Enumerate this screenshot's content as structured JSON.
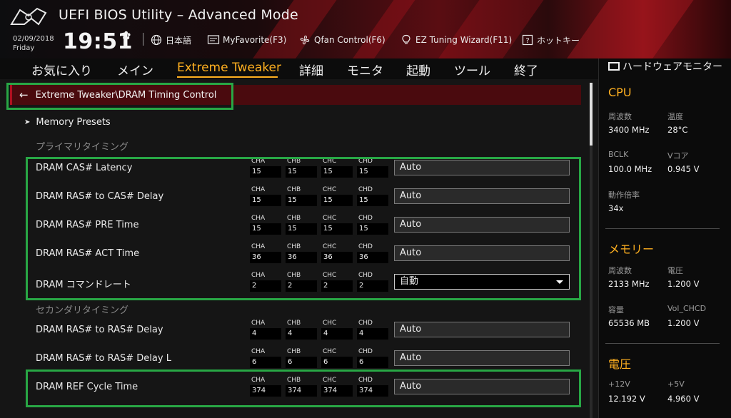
{
  "header": {
    "title": "UEFI BIOS Utility – Advanced Mode",
    "date": "02/09/2018",
    "day": "Friday",
    "time": "19:51",
    "items": [
      {
        "label": "日本語",
        "icon": "globe-icon"
      },
      {
        "label": "MyFavorite(F3)",
        "icon": "favorite-icon"
      },
      {
        "label": "Qfan Control(F6)",
        "icon": "fan-icon"
      },
      {
        "label": "EZ Tuning Wizard(F11)",
        "icon": "bulb-icon"
      },
      {
        "label": "ホットキー",
        "icon": "hotkey-icon"
      }
    ]
  },
  "nav": {
    "tabs": [
      "お気に入り",
      "メイン",
      "Extreme Tweaker",
      "詳細",
      "モニタ",
      "起動",
      "ツール",
      "終了"
    ],
    "active": "Extreme Tweaker"
  },
  "breadcrumb": "Extreme Tweaker\\DRAM Timing Control",
  "presets": "Memory Presets",
  "sections": {
    "primary": "プライマリタイミング",
    "secondary": "セカンダリタイミング"
  },
  "channels": [
    "CHA",
    "CHB",
    "CHC",
    "CHD"
  ],
  "rows": [
    {
      "label": "DRAM CAS# Latency",
      "values": [
        "15",
        "15",
        "15",
        "15"
      ],
      "setting": "Auto"
    },
    {
      "label": "DRAM RAS# to CAS# Delay",
      "values": [
        "15",
        "15",
        "15",
        "15"
      ],
      "setting": "Auto"
    },
    {
      "label": "DRAM RAS# PRE Time",
      "values": [
        "15",
        "15",
        "15",
        "15"
      ],
      "setting": "Auto"
    },
    {
      "label": "DRAM RAS# ACT Time",
      "values": [
        "36",
        "36",
        "36",
        "36"
      ],
      "setting": "Auto"
    },
    {
      "label": "DRAM コマンドレート",
      "values": [
        "2",
        "2",
        "2",
        "2"
      ],
      "setting": "自動"
    },
    {
      "label": "DRAM RAS# to RAS# Delay",
      "values": [
        "4",
        "4",
        "4",
        "4"
      ],
      "setting": "Auto"
    },
    {
      "label": "DRAM RAS# to RAS# Delay L",
      "values": [
        "6",
        "6",
        "6",
        "6"
      ],
      "setting": "Auto"
    },
    {
      "label": "DRAM REF Cycle Time",
      "values": [
        "374",
        "374",
        "374",
        "374"
      ],
      "setting": "Auto"
    }
  ],
  "hw": {
    "title": "ハードウェアモニター",
    "cpu": {
      "head": "CPU",
      "freq_label": "周波数",
      "freq": "3400 MHz",
      "temp_label": "温度",
      "temp": "28°C",
      "bclk_label": "BCLK",
      "bclk": "100.0 MHz",
      "vcore_label": "Vコア",
      "vcore": "0.945 V",
      "ratio_label": "動作倍率",
      "ratio": "34x"
    },
    "mem": {
      "head": "メモリー",
      "freq_label": "周波数",
      "freq": "2133 MHz",
      "volt_label": "電圧",
      "volt": "1.200 V",
      "cap_label": "容量",
      "cap": "65536 MB",
      "vol_chcd_label": "Vol_CHCD",
      "vol_chcd": "1.200 V"
    },
    "volt": {
      "head": "電圧",
      "v12_label": "+12V",
      "v12": "12.192 V",
      "v5_label": "+5V",
      "v5": "4.960 V"
    }
  }
}
